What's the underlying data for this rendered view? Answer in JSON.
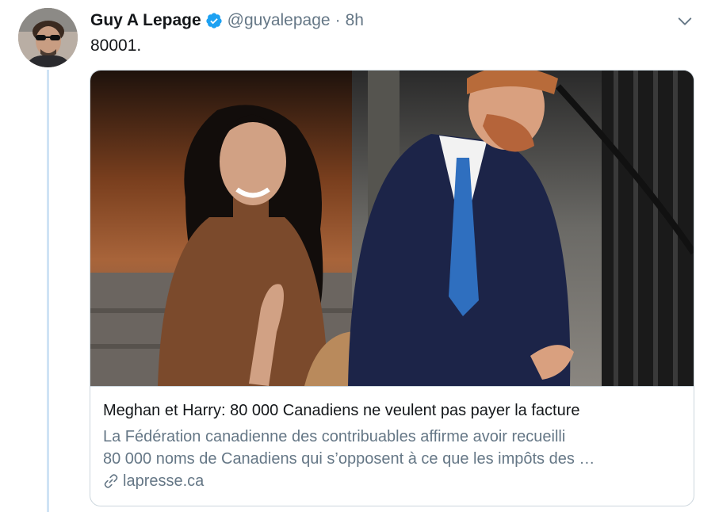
{
  "tweet": {
    "display_name": "Guy A Lepage",
    "handle": "@guyalepage",
    "separator": "·",
    "time": "8h",
    "text": "80001.",
    "verified": true,
    "icons": {
      "verified": "verified-badge-icon",
      "menu": "chevron-down-icon",
      "link": "link-icon"
    },
    "colors": {
      "verified_blue": "#1da1f2",
      "secondary_text": "#657786",
      "thread_line": "#cfe3f5"
    }
  },
  "card": {
    "title": "Meghan et Harry: 80 000 Canadiens ne veulent pas payer la facture",
    "description_line1": "La Fédération canadienne des contribuables affirme avoir recueilli",
    "description_line2": "80 000 noms de Canadiens qui s’opposent à ce que les impôts des …",
    "domain": "lapresse.ca"
  }
}
